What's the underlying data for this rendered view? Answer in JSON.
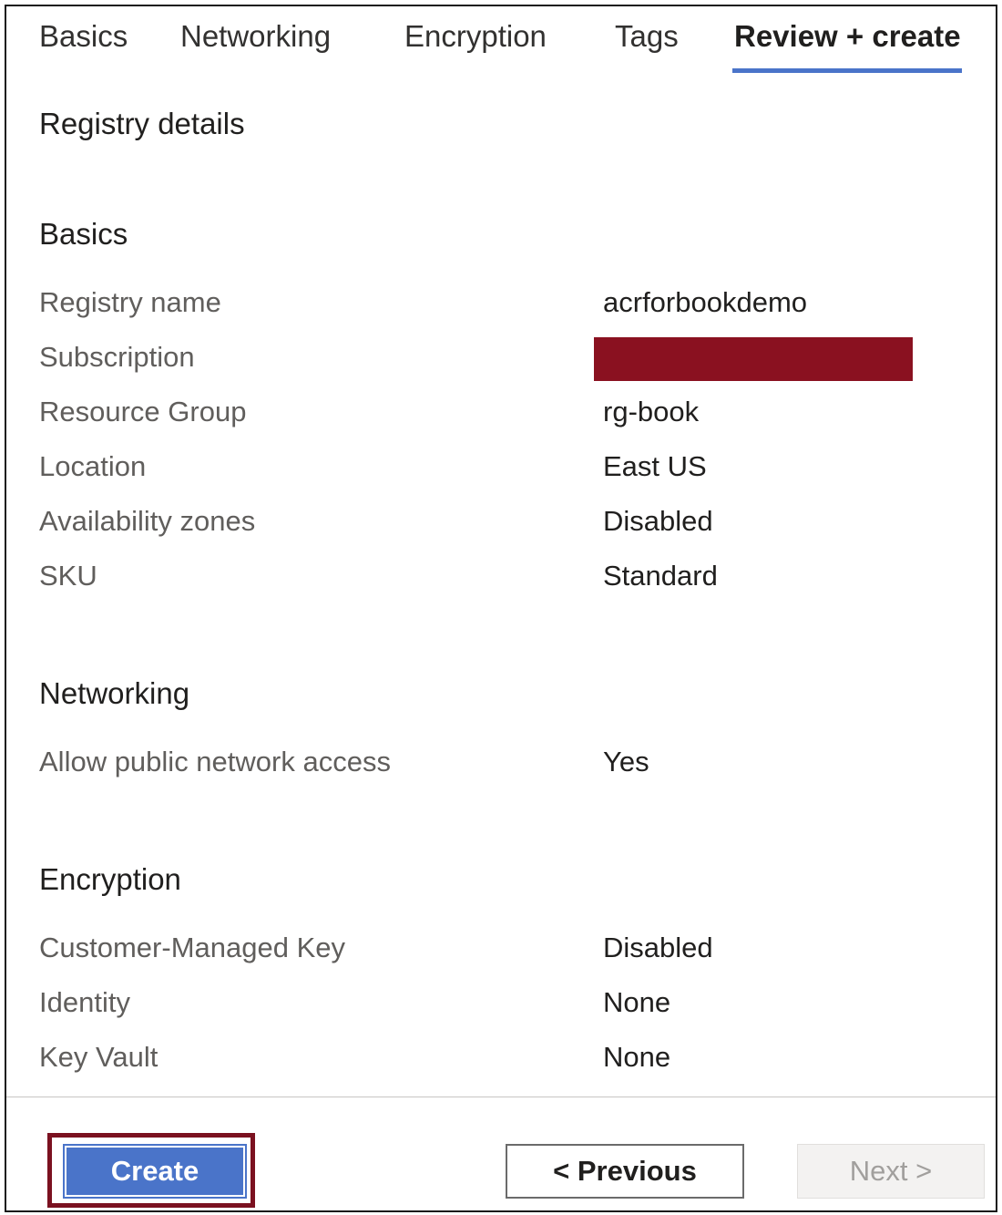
{
  "tabs": [
    {
      "label": "Basics",
      "active": false
    },
    {
      "label": "Networking",
      "active": false
    },
    {
      "label": "Encryption",
      "active": false
    },
    {
      "label": "Tags",
      "active": false
    },
    {
      "label": "Review + create",
      "active": true
    }
  ],
  "page_title": "Registry details",
  "sections": {
    "basics": {
      "title": "Basics",
      "rows": [
        {
          "label": "Registry name",
          "value": "acrforbookdemo"
        },
        {
          "label": "Subscription",
          "value": null,
          "redacted": true
        },
        {
          "label": "Resource Group",
          "value": "rg-book"
        },
        {
          "label": "Location",
          "value": "East US"
        },
        {
          "label": "Availability zones",
          "value": "Disabled"
        },
        {
          "label": "SKU",
          "value": "Standard"
        }
      ]
    },
    "networking": {
      "title": "Networking",
      "rows": [
        {
          "label": "Allow public network access",
          "value": "Yes"
        }
      ]
    },
    "encryption": {
      "title": "Encryption",
      "rows": [
        {
          "label": "Customer-Managed Key",
          "value": "Disabled"
        },
        {
          "label": "Identity",
          "value": "None"
        },
        {
          "label": "Key Vault",
          "value": "None"
        }
      ]
    }
  },
  "footer": {
    "create_label": "Create",
    "previous_label": "< Previous",
    "next_label": "Next >",
    "next_disabled": true
  },
  "colors": {
    "accent": "#4a74c9",
    "highlight_border": "#7b1120",
    "redaction": "#8a1120"
  }
}
